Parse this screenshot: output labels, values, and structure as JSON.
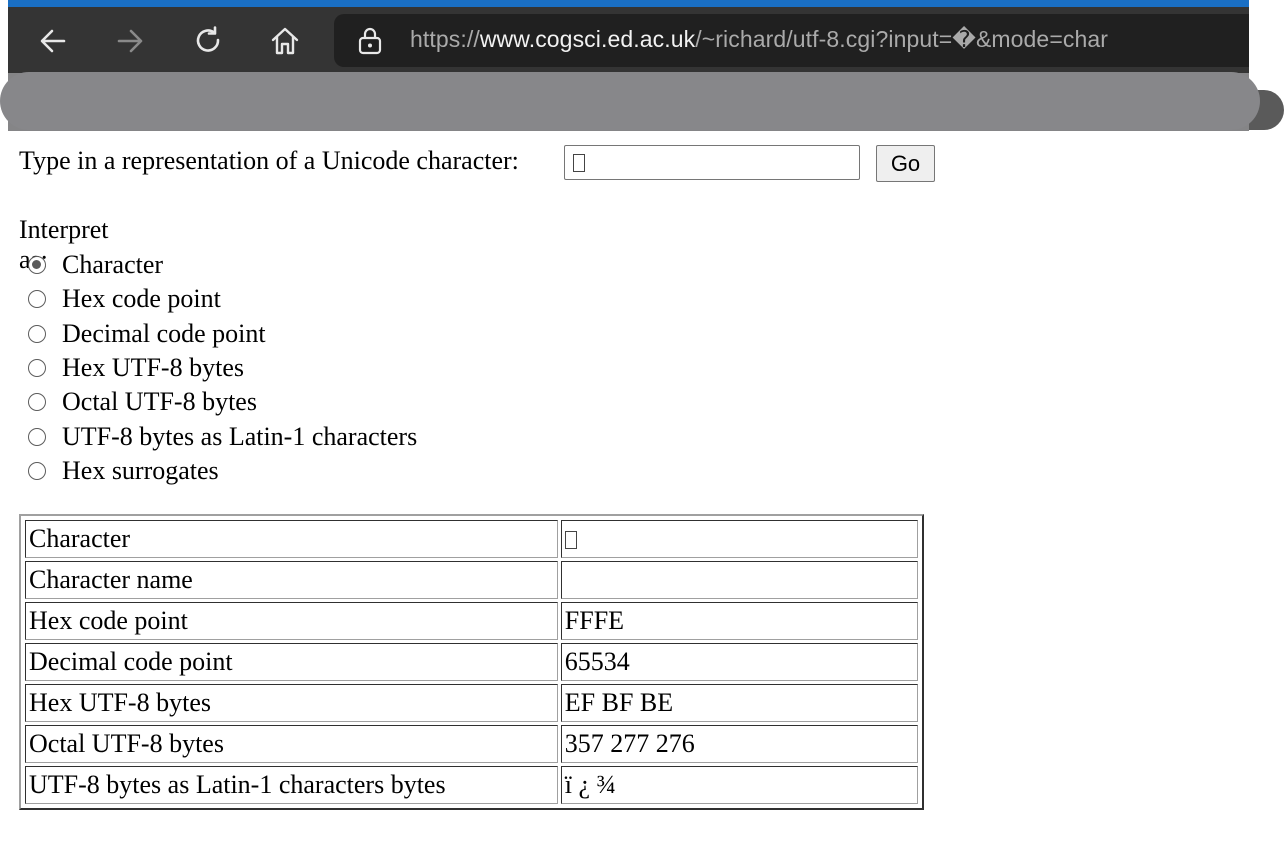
{
  "browser": {
    "url_scheme": "https://",
    "url_host": "www.cogsci.ed.ac.uk",
    "url_path": "/~richard/utf-8.cgi?input=�&mode=char",
    "back_icon": "arrow-left-icon",
    "forward_icon": "arrow-right-icon",
    "refresh_icon": "refresh-icon",
    "home_icon": "home-icon",
    "lock_icon": "lock-icon"
  },
  "form": {
    "prompt": "Type in a representation of a Unicode character:",
    "input_value": "",
    "go_label": "Go",
    "interpret_label": "Interpret as:",
    "options": [
      {
        "label": "Character",
        "checked": true
      },
      {
        "label": "Hex code point",
        "checked": false
      },
      {
        "label": "Decimal code point",
        "checked": false
      },
      {
        "label": "Hex UTF-8 bytes",
        "checked": false
      },
      {
        "label": "Octal UTF-8 bytes",
        "checked": false
      },
      {
        "label": "UTF-8 bytes as Latin-1 characters",
        "checked": false
      },
      {
        "label": "Hex surrogates",
        "checked": false
      }
    ]
  },
  "result": {
    "rows": [
      {
        "key": "Character",
        "value": ""
      },
      {
        "key": "Character name",
        "value": ""
      },
      {
        "key": "Hex code point",
        "value": "FFFE"
      },
      {
        "key": "Decimal code point",
        "value": "65534"
      },
      {
        "key": "Hex UTF-8 bytes",
        "value": "EF BF BE"
      },
      {
        "key": "Octal UTF-8 bytes",
        "value": "357 277 276"
      },
      {
        "key": "UTF-8 bytes as Latin-1 characters bytes",
        "value": "ï ¿ ¾"
      }
    ]
  },
  "colors": {
    "tab_accent": "#1a6fc4",
    "toolbar_bg": "#343434",
    "urlbar_bg": "#202020"
  }
}
